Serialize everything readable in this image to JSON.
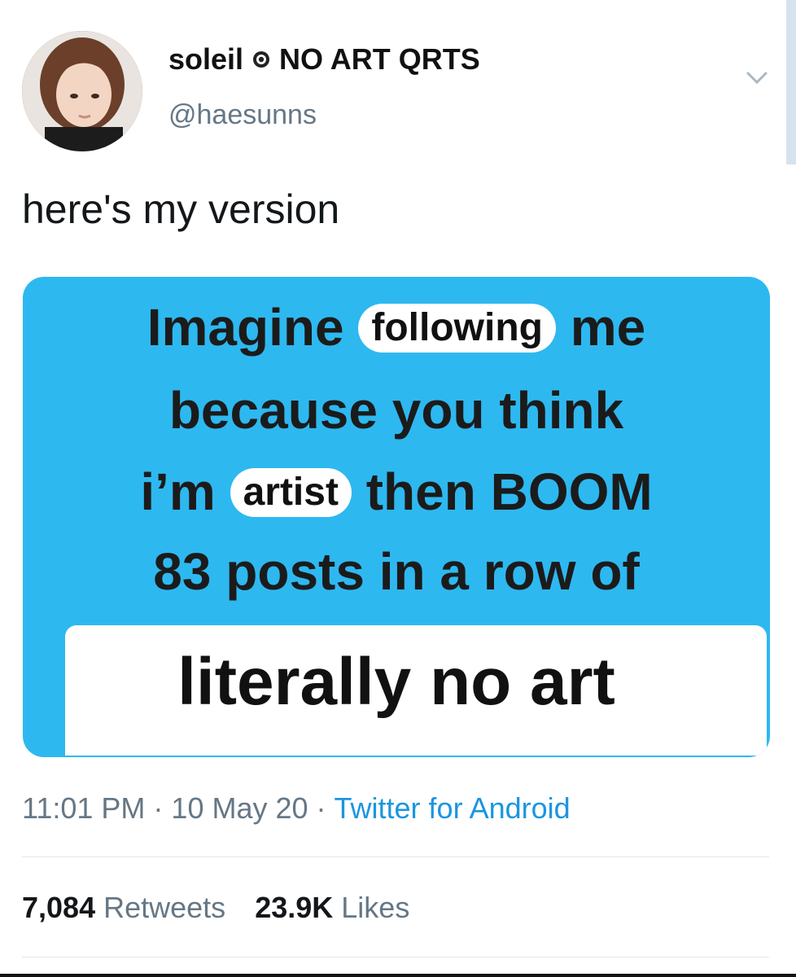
{
  "author": {
    "display_name": "soleil",
    "name_suffix": "NO ART QRTS",
    "handle": "@haesunns"
  },
  "tweet": {
    "text": "here's my version"
  },
  "media": {
    "line1_start": "Imagine",
    "line1_chip": "following",
    "line1_end": "me",
    "line2": "because you think",
    "line3_start": "i’m",
    "line3_chip": "artist",
    "line3_end": "then BOOM",
    "line4": "83 posts in a row of",
    "line5": "literally no art",
    "background_color": "#2eb8f0"
  },
  "meta": {
    "time": "11:01 PM",
    "separator": "·",
    "date": "10 May 20",
    "source": "Twitter for Android"
  },
  "stats": {
    "retweets_count": "7,084",
    "retweets_label": "Retweets",
    "likes_count": "23.9K",
    "likes_label": "Likes"
  },
  "colors": {
    "link": "#1b95e0",
    "muted": "#657786"
  },
  "icons": {
    "badge": "circle-badge-icon",
    "caret": "chevron-down-icon"
  }
}
